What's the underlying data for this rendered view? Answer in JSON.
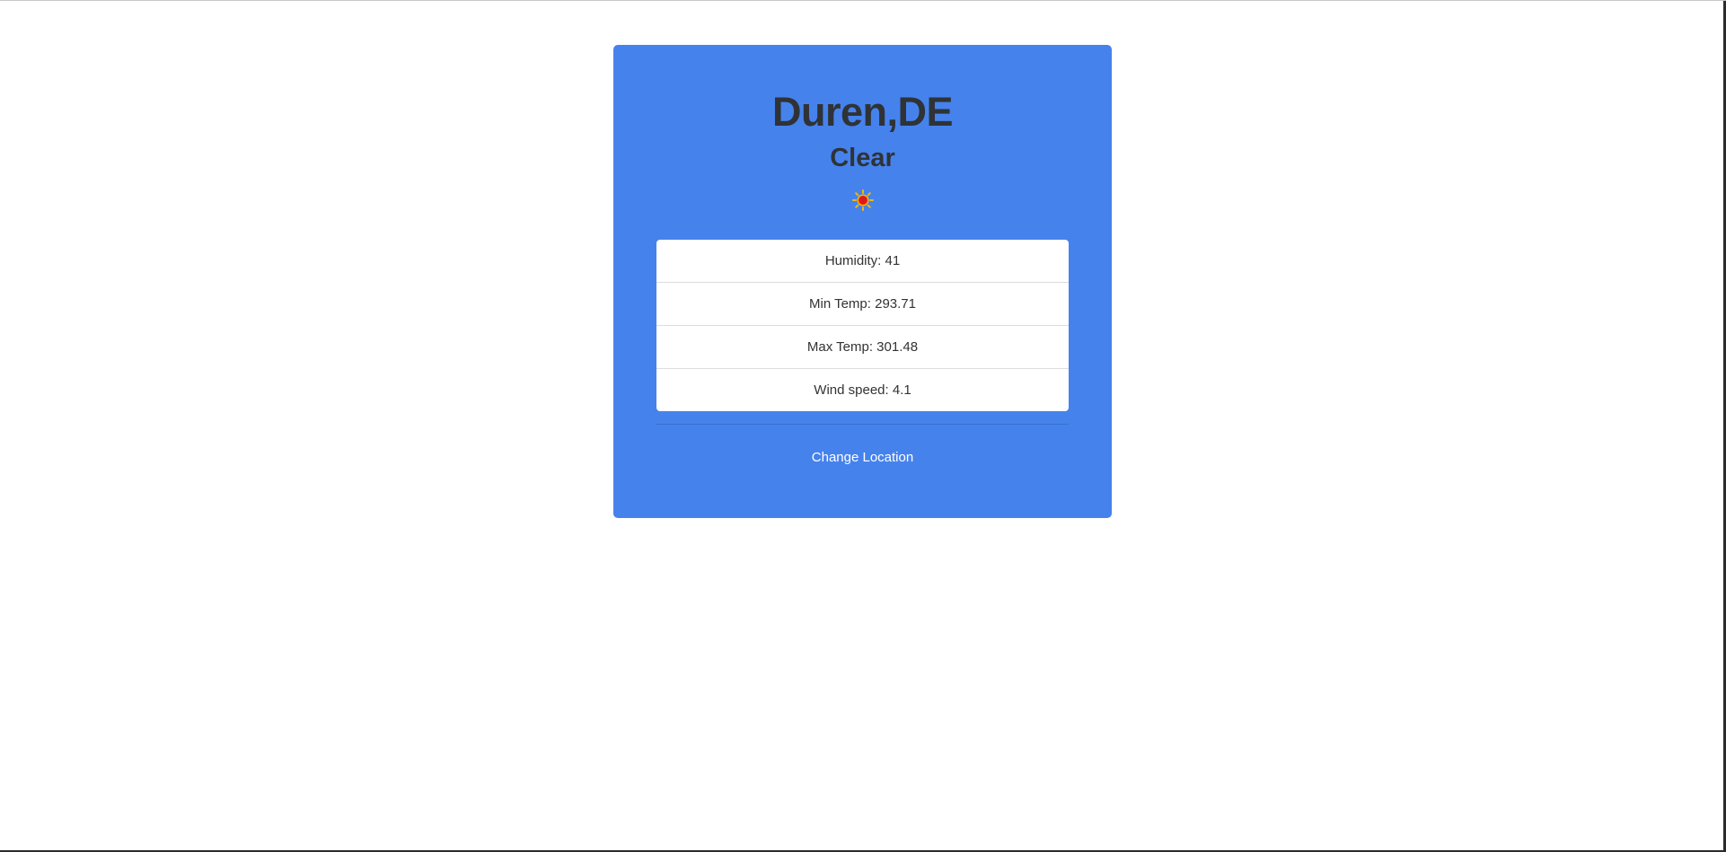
{
  "weather": {
    "location": "Duren,DE",
    "condition": "Clear",
    "icon": "sun-icon",
    "details": [
      {
        "label": "Humidity: 41"
      },
      {
        "label": "Min Temp: 293.71"
      },
      {
        "label": "Max Temp: 301.48"
      },
      {
        "label": "Wind speed: 4.1"
      }
    ],
    "change_location_label": "Change Location"
  },
  "colors": {
    "card_background": "#4682ec",
    "heading_text": "#2f3336",
    "link_text": "#ffffff",
    "sun_core": "#e0181b",
    "sun_rays": "#f5b800"
  }
}
